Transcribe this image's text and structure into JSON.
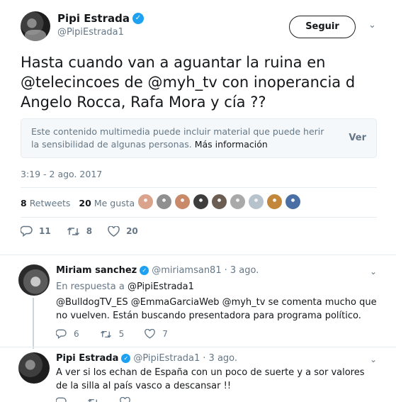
{
  "main_tweet": {
    "author_name": "Pipi Estrada",
    "author_handle": "@PipiEstrada1",
    "follow_label": "Seguir",
    "text": "Hasta cuando van a aguantar la ruina en @telecincoes de @myh_tv con inoperancia d Angelo Rocca, Rafa Mora y cía ??",
    "sensitive_notice": "Este contenido multimedia puede incluir material que puede herir la sensibilidad de algunas personas.",
    "sensitive_more": "Más información",
    "sensitive_view": "Ver",
    "timestamp": "3:19 - 2 ago. 2017",
    "retweets_count": "8",
    "retweets_label": "Retweets",
    "likes_count": "20",
    "likes_label": "Me gusta",
    "reply_count": "11",
    "retweet_action_count": "8",
    "like_action_count": "20",
    "liker_colors": [
      "#d9a38c",
      "#8f8f8f",
      "#c98a6a",
      "#3d3d3d",
      "#6b5d52",
      "#a9a9a9",
      "#b7c3cc",
      "#c2873a",
      "#4a6fa5"
    ]
  },
  "replies": [
    {
      "name": "Miriam sanchez",
      "handle": "@miriamsan81",
      "date": "· 3 ago.",
      "in_reply_label": "En respuesta a",
      "in_reply_handle": "@PipiEstrada1",
      "text": "@BulldogTV_ES @EmmaGarciaWeb @myh_tv se comenta mucho que no vuelven. Están buscando presentadora para programa político.",
      "reply_count": "6",
      "retweet_count": "5",
      "like_count": "7"
    },
    {
      "name": "Pipi Estrada",
      "handle": "@PipiEstrada1",
      "date": "· 3 ago.",
      "text": "A ver si los echan de España con un poco de suerte y a sor valores de la silla al país vasco a descansar !!",
      "reply_count": "",
      "retweet_count": "",
      "like_count": ""
    }
  ],
  "colors": {
    "verified": "#1da1f2",
    "secondary_text": "#657786",
    "divider": "#e6ecf0"
  }
}
